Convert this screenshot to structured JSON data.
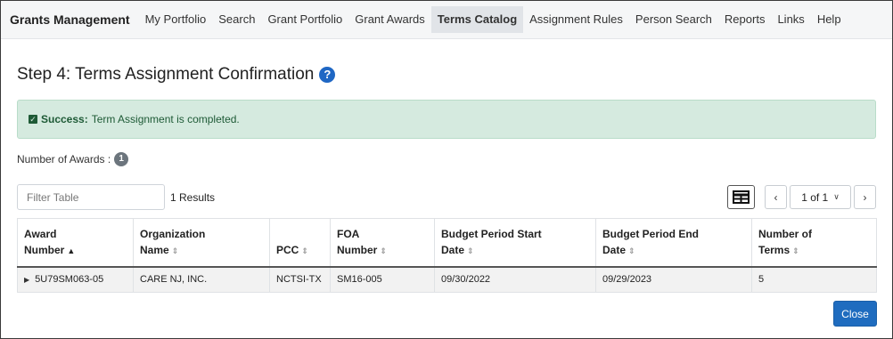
{
  "nav": {
    "brand": "Grants Management",
    "items": [
      {
        "label": "My Portfolio"
      },
      {
        "label": "Search"
      },
      {
        "label": "Grant Portfolio"
      },
      {
        "label": "Grant Awards"
      },
      {
        "label": "Terms Catalog",
        "active": true
      },
      {
        "label": "Assignment Rules"
      },
      {
        "label": "Person Search"
      },
      {
        "label": "Reports"
      },
      {
        "label": "Links"
      },
      {
        "label": "Help"
      }
    ]
  },
  "page": {
    "title": "Step 4: Terms Assignment Confirmation",
    "help_glyph": "?"
  },
  "alert": {
    "strong": "Success:",
    "message": "Term Assignment is completed."
  },
  "awards_count": {
    "label": "Number of Awards :",
    "value": "1"
  },
  "filter": {
    "placeholder": "Filter Table",
    "value": ""
  },
  "results_text": "1 Results",
  "pager": {
    "current": "1 of 1",
    "prev_glyph": "‹",
    "next_glyph": "›"
  },
  "table": {
    "columns": [
      {
        "line1": "Award",
        "line2": "Number",
        "sort": "▲"
      },
      {
        "line1": "Organization",
        "line2": "Name",
        "sort": "⇕"
      },
      {
        "line1": "",
        "line2": "PCC",
        "sort": "⇕"
      },
      {
        "line1": "FOA",
        "line2": "Number",
        "sort": "⇕"
      },
      {
        "line1": "Budget Period Start",
        "line2": "Date",
        "sort": "⇕"
      },
      {
        "line1": "Budget Period End",
        "line2": "Date",
        "sort": "⇕"
      },
      {
        "line1": "Number of",
        "line2": "Terms",
        "sort": "⇕"
      }
    ],
    "rows": [
      [
        "5U79SM063-05",
        "CARE NJ, INC.",
        "NCTSI-TX",
        "SM16-005",
        "09/30/2022",
        "09/29/2023",
        "5"
      ]
    ]
  },
  "close_button": "Close",
  "icons": {
    "help": "help-circle-icon",
    "success": "check-square-icon",
    "grid": "table-grid-icon",
    "expand": "caret-right-icon"
  }
}
